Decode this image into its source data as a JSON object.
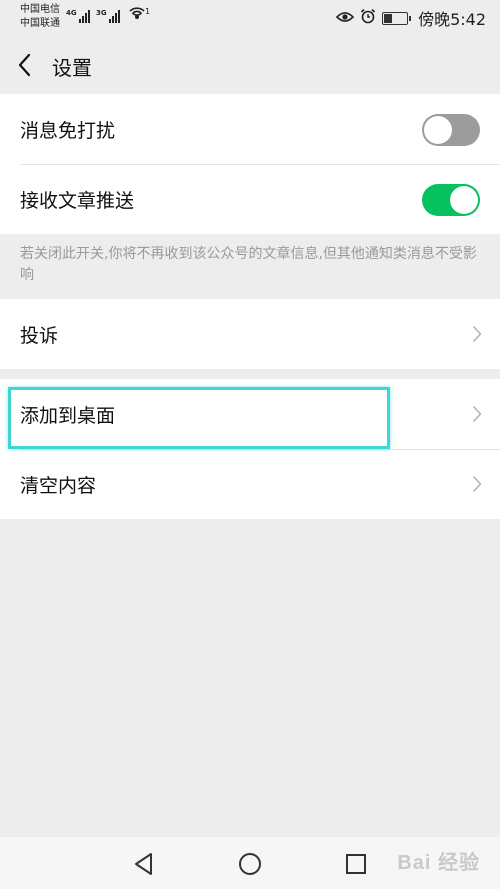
{
  "status_bar": {
    "carrier_1": "中国电信",
    "carrier_2": "中国联通",
    "signal_1_tag": "4G",
    "signal_2_tag": "3G",
    "wifi_tag": "1",
    "time": "傍晚5:42"
  },
  "header": {
    "title": "设置"
  },
  "settings": {
    "mute_label": "消息免打扰",
    "mute_on": false,
    "push_label": "接收文章推送",
    "push_on": true,
    "push_note": "若关闭此开关,你将不再收到该公众号的文章信息,但其他通知类消息不受影响"
  },
  "actions": {
    "complain_label": "投诉",
    "add_desktop_label": "添加到桌面",
    "clear_label": "清空内容"
  },
  "watermark": {
    "text": "Bai 经验"
  },
  "colors": {
    "toggle_on": "#07c160",
    "toggle_off": "#9c9c9c",
    "highlight": "#3ed6d3"
  }
}
